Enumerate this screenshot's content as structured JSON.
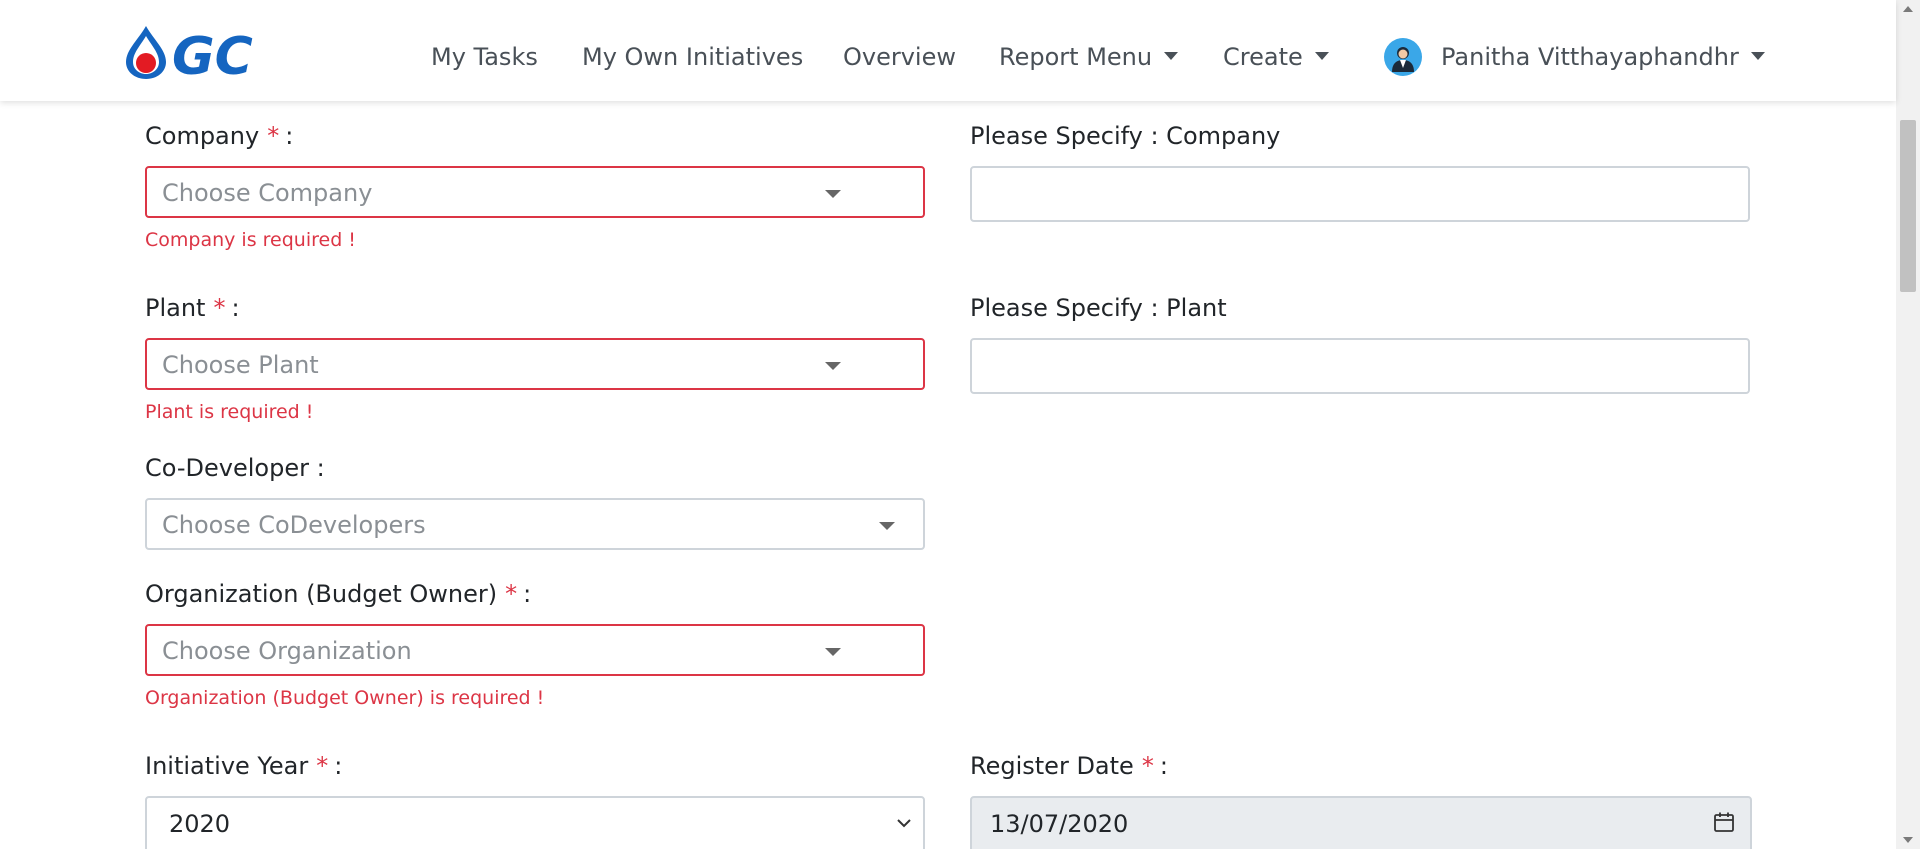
{
  "brand": {
    "logo_text": "GC",
    "icon": "flame-drop-logo"
  },
  "nav": {
    "items": [
      {
        "label": "My Tasks"
      },
      {
        "label": "My Own Initiatives"
      },
      {
        "label": "Overview"
      },
      {
        "label": "Report Menu",
        "dropdown": true
      },
      {
        "label": "Create",
        "dropdown": true
      }
    ],
    "user": {
      "name": "Panitha Vitthayaphandhr",
      "icon": "user-avatar-icon"
    }
  },
  "form": {
    "company": {
      "label": "Company",
      "required_mark": "*",
      "colon": ":",
      "placeholder": "Choose Company",
      "error": "Company is required !"
    },
    "specify_company": {
      "label": "Please Specify : Company",
      "value": ""
    },
    "plant": {
      "label": "Plant",
      "required_mark": "*",
      "colon": ":",
      "placeholder": "Choose Plant",
      "error": "Plant is required !"
    },
    "specify_plant": {
      "label": "Please Specify : Plant",
      "value": ""
    },
    "co_developer": {
      "label": "Co-Developer :",
      "placeholder": "Choose CoDevelopers"
    },
    "organization": {
      "label": "Organization (Budget Owner)",
      "required_mark": "*",
      "colon": ":",
      "placeholder": "Choose Organization",
      "error": "Organization (Budget Owner) is required !"
    },
    "initiative_year": {
      "label": "Initiative Year",
      "required_mark": "*",
      "colon": ":",
      "value": "2020"
    },
    "register_date": {
      "label": "Register Date",
      "required_mark": "*",
      "colon": ":",
      "value": "13/07/2020"
    }
  },
  "colors": {
    "brand_blue": "#1565c0",
    "error_red": "#dc3545",
    "border_gray": "#ced4da",
    "disabled_bg": "#e9ecef"
  }
}
